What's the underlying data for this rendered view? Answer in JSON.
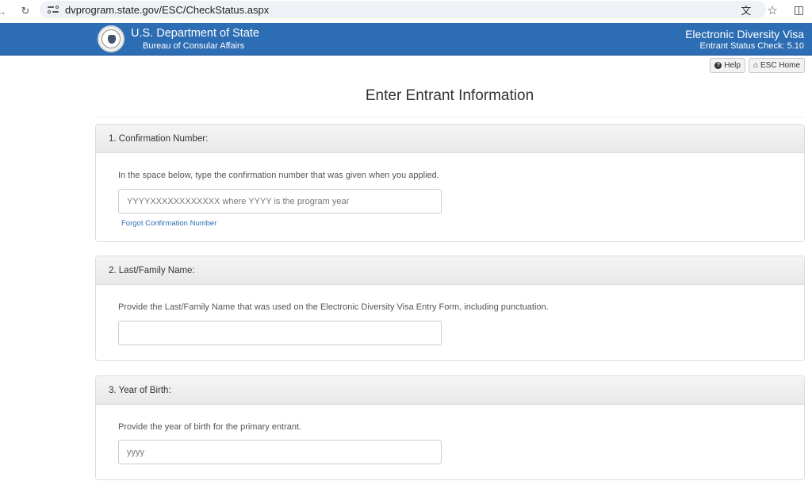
{
  "browser": {
    "url": "dvprogram.state.gov/ESC/CheckStatus.aspx",
    "icons": [
      "back-arrow-icon",
      "reload-icon",
      "site-settings-icon",
      "translate-icon",
      "bookmark-star-icon",
      "extensions-icon"
    ]
  },
  "header": {
    "agency": "U.S. Department of State",
    "bureau": "Bureau of Consular Affairs",
    "app_title": "Electronic Diversity Visa",
    "app_subtitle": "Entrant Status Check: 5.10",
    "brand_color": "#2c6db4"
  },
  "toolbar": {
    "help_label": "Help",
    "home_label": "ESC Home"
  },
  "page": {
    "title": "Enter Entrant Information"
  },
  "sections": {
    "confirmation": {
      "heading": "1. Confirmation Number:",
      "instructions": "In the space below, type the confirmation number that was given when you applied.",
      "placeholder": "YYYYXXXXXXXXXXXX where YYYY is the program year",
      "value": "",
      "link": "Forgot Confirmation Number"
    },
    "last_name": {
      "heading": "2. Last/Family Name:",
      "instructions": "Provide the Last/Family Name that was used on the Electronic Diversity Visa Entry Form, including punctuation.",
      "placeholder": "",
      "value": ""
    },
    "birth_year": {
      "heading": "3. Year of Birth:",
      "instructions": "Provide the year of birth for the primary entrant.",
      "placeholder": "yyyy",
      "value": ""
    }
  }
}
